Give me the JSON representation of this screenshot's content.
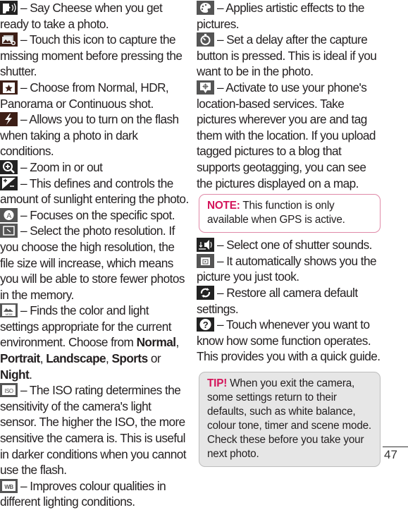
{
  "left_column": [
    {
      "icon": "say-cheese-icon",
      "text": "– Say Cheese when you get ready to take a photo."
    },
    {
      "icon": "time-catch-icon",
      "text": "– Touch this icon to capture the missing moment before pressing the shutter."
    },
    {
      "icon": "shot-mode-icon",
      "text": "– Choose from Normal, HDR, Panorama or Continuous shot."
    },
    {
      "icon": "flash-icon",
      "text": "– Allows you to turn on the flash when taking a photo in dark conditions."
    },
    {
      "icon": "zoom-icon",
      "text": "– Zoom in or out"
    },
    {
      "icon": "brightness-icon",
      "text": "– This defines and controls the amount of sunlight entering the photo."
    },
    {
      "icon": "focus-icon",
      "text": "– Focuses on the specific spot."
    },
    {
      "icon": "image-size-icon",
      "text": "– Select the photo resolution. If you choose the high resolution, the file size will increase, which means you will be able to store fewer photos in the memory."
    },
    {
      "icon": "scene-mode-icon",
      "text_pre": "– Finds the color and light settings appropriate for the current environment. Choose from ",
      "options": [
        "Normal",
        "Portrait",
        "Landscape",
        "Sports",
        "Night"
      ],
      "sep1": ", ",
      "sep2": ", ",
      "sep3": ", ",
      "sep4": " or ",
      "text_post": "."
    },
    {
      "icon": "iso-icon",
      "text": "– The ISO rating determines the sensitivity of the camera's light sensor. The higher the ISO, the more sensitive the camera is. This is useful in darker conditions when you cannot use the flash."
    },
    {
      "icon": "white-balance-icon",
      "text": "– Improves colour qualities in different lighting conditions."
    }
  ],
  "right_column": [
    {
      "icon": "color-effect-icon",
      "text": "– Applies artistic effects to the pictures."
    },
    {
      "icon": "timer-icon",
      "text": "– Set a delay after the capture button is pressed. This is ideal if you want to be in the photo."
    },
    {
      "icon": "geotagging-icon",
      "text": "– Activate to use your phone's location-based services. Take pictures wherever you are and tag them with the location. If you upload tagged pictures to a blog that supports geotagging, you can see the pictures displayed on a map."
    },
    {
      "icon": "shutter-sound-icon",
      "text": "– Select one of shutter sounds."
    },
    {
      "icon": "auto-review-icon",
      "text": "– It automatically shows you the picture you just took."
    },
    {
      "icon": "reset-icon",
      "text": "– Restore all camera default settings."
    },
    {
      "icon": "help-icon",
      "text": "– Touch whenever you want to know how some function operates. This provides you with a quick guide."
    }
  ],
  "note": {
    "label": "NOTE:",
    "text": " This function is only available when GPS is active."
  },
  "tip": {
    "label": "TIP!",
    "text": " When you exit the camera, some settings return to their defaults, such as white balance, colour tone, timer and scene mode. Check these before you take your next photo."
  },
  "page_number": "47",
  "colors": {
    "accent": "#d4145a",
    "note_border": "#e08aa8",
    "tip_bg": "#e6e6e6"
  }
}
